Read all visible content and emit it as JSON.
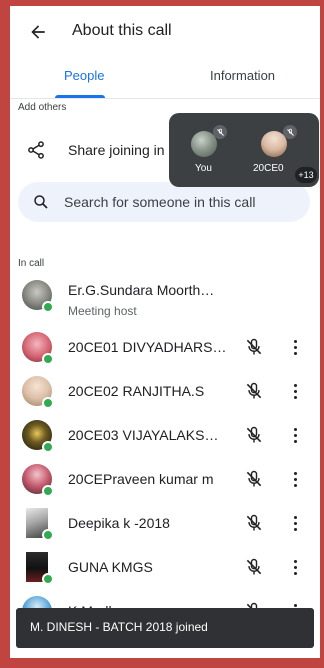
{
  "header": {
    "title": "About this call"
  },
  "tabs": [
    {
      "label": "People",
      "selected": true
    },
    {
      "label": "Information",
      "selected": false
    }
  ],
  "add_others": {
    "heading": "Add others",
    "share_label": "Share joining in"
  },
  "search": {
    "placeholder": "Search for someone in this call"
  },
  "pip": {
    "tiles": [
      {
        "name": "You"
      },
      {
        "name": "20CE0"
      }
    ],
    "more_count": "+13"
  },
  "in_call": {
    "heading": "In call",
    "host": {
      "name": "Er.G.Sundara Moorth…",
      "role": "Meeting host"
    },
    "participants": [
      {
        "name": "20CE01 DIVYADHARS…"
      },
      {
        "name": "20CE02 RANJITHA.S"
      },
      {
        "name": "20CE03 VIJAYALAKS…"
      },
      {
        "name": "20CEPraveen kumar m"
      },
      {
        "name": "Deepika k -2018"
      },
      {
        "name": "GUNA KMGS"
      },
      {
        "name": "K.Madhan"
      }
    ]
  },
  "toast": {
    "text": "M. DINESH - BATCH 2018 joined"
  },
  "colors": {
    "accent": "#1a73e8",
    "online": "#34a853",
    "frame": "#c0443f"
  }
}
